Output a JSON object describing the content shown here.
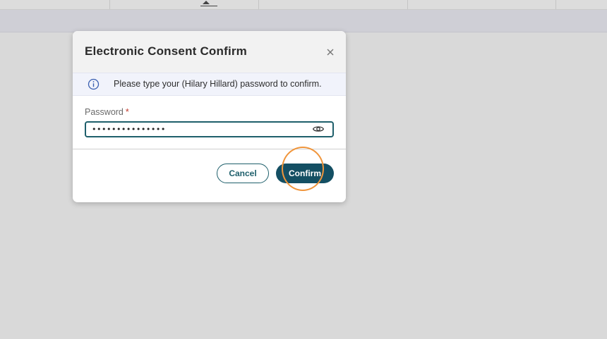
{
  "modal": {
    "title": "Electronic Consent Confirm",
    "close_icon": "close-icon",
    "info": {
      "icon": "info-icon",
      "text": "Please type your (Hilary Hillard) password to confirm."
    },
    "password": {
      "label": "Password",
      "required_marker": "*",
      "value": "•••••••••••••••",
      "reveal_icon": "eye-icon"
    },
    "buttons": {
      "cancel_label": "Cancel",
      "confirm_label": "Confirm"
    }
  },
  "colors": {
    "accent": "#144f63",
    "required": "#c0392b",
    "highlight_ring": "#f0953b",
    "backdrop": "#d9d9d9"
  }
}
